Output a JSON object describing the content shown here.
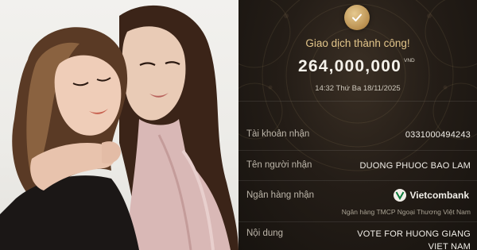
{
  "photo": {
    "description_icon": "photo-of-two-people"
  },
  "receipt": {
    "status_icon": "check-icon",
    "title": "Giao dịch thành công!",
    "amount": "264,000,000",
    "currency": "VND",
    "datetime": "14:32 Thứ Ba 18/11/2025",
    "rows": {
      "account": {
        "label": "Tài khoản nhận",
        "value": "0331000494243"
      },
      "recipient": {
        "label": "Tên người nhận",
        "value": "DUONG PHUOC BAO LAM"
      },
      "bank": {
        "label": "Ngân hàng nhận",
        "logo_text": "Vietcombank",
        "full_name": "Ngân hàng TMCP Ngoại Thương Việt Nam"
      },
      "content": {
        "label": "Nội dung",
        "value": "VOTE FOR HUONG GIANG VIET NAM"
      }
    },
    "colors": {
      "gold": "#e2c58a",
      "background": "#241d17",
      "vcb_green": "#0a7a3a"
    }
  }
}
